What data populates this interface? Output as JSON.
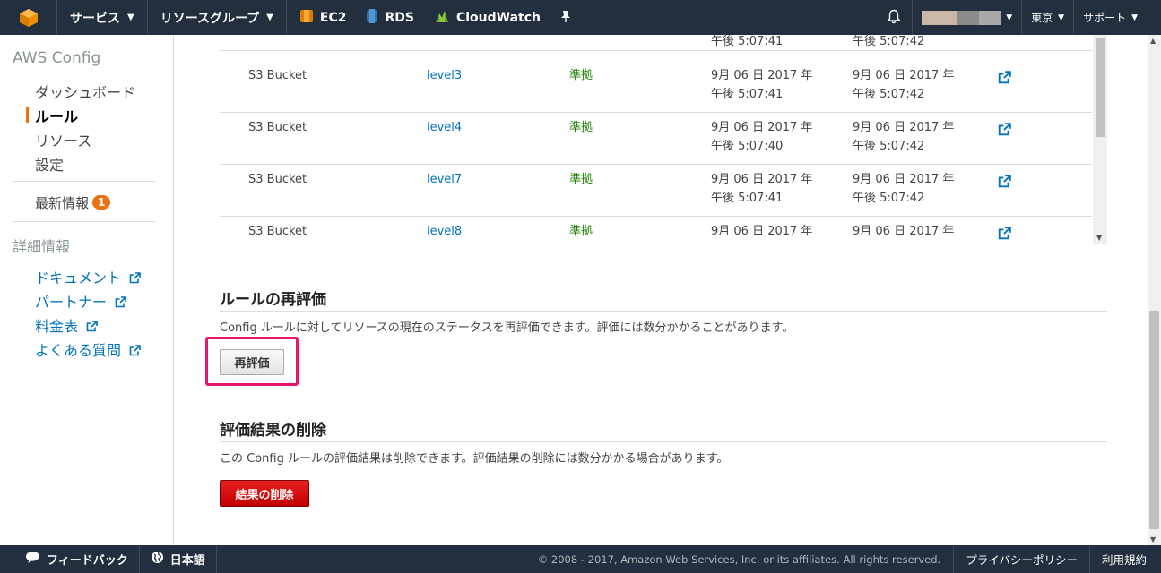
{
  "topnav": {
    "services": "サービス",
    "resource_groups": "リソースグループ",
    "shortcuts": [
      "EC2",
      "RDS",
      "CloudWatch"
    ],
    "region": "東京",
    "support": "サポート",
    "colors": {
      "bg": "#232f3e",
      "accent": "#ec7211"
    },
    "icons": {
      "logo": "aws-cube-icon",
      "pin": "pin-icon",
      "bell": "bell-icon"
    }
  },
  "sidebar": {
    "title": "AWS Config",
    "items": [
      {
        "label": "ダッシュボード"
      },
      {
        "label": "ルール"
      },
      {
        "label": "リソース"
      },
      {
        "label": "設定"
      }
    ],
    "whats_new": {
      "label": "最新情報",
      "badge": "1"
    },
    "more_info": {
      "title": "詳細情報",
      "links": [
        "ドキュメント",
        "パートナー",
        "料金表",
        "よくある質問"
      ]
    }
  },
  "table": {
    "partial_top": {
      "t1_time": "午後 5:07:41",
      "t2_time": "午後 5:07:42"
    },
    "rows": [
      {
        "type": "S3 Bucket",
        "name": "level3",
        "status": "準拠",
        "t1_date": "9月 06 日 2017 年",
        "t1_time": "午後 5:07:41",
        "t2_date": "9月 06 日 2017 年",
        "t2_time": "午後 5:07:42"
      },
      {
        "type": "S3 Bucket",
        "name": "level4",
        "status": "準拠",
        "t1_date": "9月 06 日 2017 年",
        "t1_time": "午後 5:07:40",
        "t2_date": "9月 06 日 2017 年",
        "t2_time": "午後 5:07:42"
      },
      {
        "type": "S3 Bucket",
        "name": "level7",
        "status": "準拠",
        "t1_date": "9月 06 日 2017 年",
        "t1_time": "午後 5:07:41",
        "t2_date": "9月 06 日 2017 年",
        "t2_time": "午後 5:07:42"
      },
      {
        "type": "S3 Bucket",
        "name": "level8",
        "status": "準拠",
        "t1_date": "9月 06 日 2017 年",
        "t1_time": "",
        "t2_date": "9月 06 日 2017 年",
        "t2_time": ""
      }
    ]
  },
  "reevaluate": {
    "heading": "ルールの再評価",
    "description": "Config ルールに対してリソースの現在のステータスを再評価できます。評価には数分かかることがあります。",
    "button": "再評価"
  },
  "delete_results": {
    "heading": "評価結果の削除",
    "description": "この Config ルールの評価結果は削除できます。評価結果の削除には数分かかる場合があります。",
    "button": "結果の削除"
  },
  "footer": {
    "feedback": "フィードバック",
    "language": "日本語",
    "copyright": "© 2008 - 2017, Amazon Web Services, Inc. or its affiliates. All rights reserved.",
    "privacy": "プライバシーポリシー",
    "terms": "利用規約"
  }
}
